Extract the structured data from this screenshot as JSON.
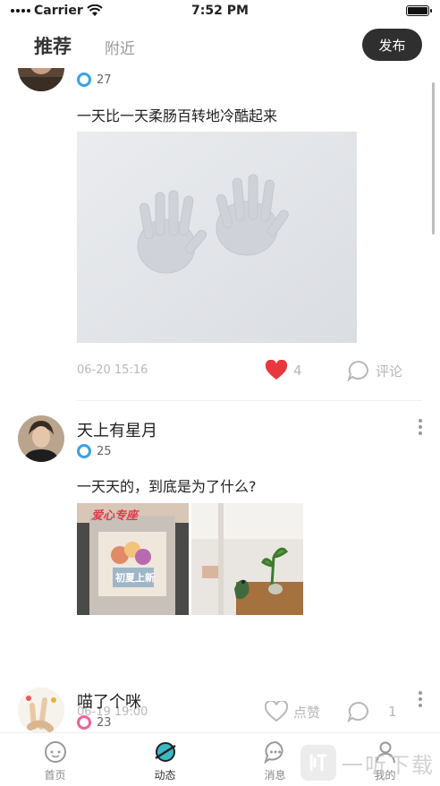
{
  "status_bar": {
    "carrier": "Carrier",
    "time": "7:52 PM",
    "battery_level": 1.0
  },
  "header": {
    "tabs": [
      {
        "label": "推荐",
        "active": true
      },
      {
        "label": "附近",
        "active": false
      }
    ],
    "publish_label": "发布"
  },
  "posts": [
    {
      "username": "",
      "level": "27",
      "text": "一天比一天柔肠百转地冷酷起来",
      "time": "06-20 15:16",
      "likes": "4",
      "liked": true,
      "comment_label": "评论"
    },
    {
      "username": "天上有星月",
      "level": "25",
      "text": "一天天的，到底是为了什么?",
      "images": [
        {
          "sign_text": "爱心专座",
          "poster_text": "初夏上新"
        },
        {
          "desc": ""
        }
      ],
      "time": "06-19 19:00",
      "like_label": "点赞",
      "comments": "1"
    },
    {
      "username": "喵了个咪",
      "level": "23"
    }
  ],
  "tabbar": {
    "items": [
      {
        "label": "首页",
        "icon": "home-chat-icon",
        "active": false
      },
      {
        "label": "动态",
        "icon": "planet-icon",
        "active": true
      },
      {
        "label": "消息",
        "icon": "message-bubble-icon",
        "active": false
      },
      {
        "label": "我的",
        "icon": "user-icon",
        "active": false
      }
    ]
  },
  "watermark": {
    "text": "一听下载"
  },
  "colors": {
    "accent_dark": "#2f2f2f",
    "like_red": "#e8383d",
    "level_blue": "#3aa0e8",
    "level_pink": "#f0609a",
    "active_tab_teal": "#3bb8c4"
  }
}
